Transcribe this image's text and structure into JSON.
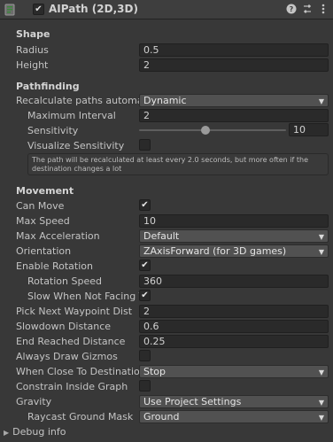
{
  "header": {
    "title": "AIPath (2D,3D)",
    "enabled_mark": "✔",
    "icons": [
      "script-icon",
      "help-icon",
      "preset-icon",
      "context-menu-icon"
    ]
  },
  "shape": {
    "heading": "Shape",
    "radius_label": "Radius",
    "radius_value": "0.5",
    "height_label": "Height",
    "height_value": "2"
  },
  "pathfinding": {
    "heading": "Pathfinding",
    "recalc_label": "Recalculate paths automatic",
    "recalc_value": "Dynamic",
    "max_interval_label": "Maximum Interval",
    "max_interval_value": "2",
    "sensitivity_label": "Sensitivity",
    "sensitivity_value": "10",
    "sensitivity_fraction": 0.45,
    "visualize_label": "Visualize Sensitivity",
    "help_text": "The path will be recalculated at least every 2.0 seconds, but more often if the destination changes a lot"
  },
  "movement": {
    "heading": "Movement",
    "can_move_label": "Can Move",
    "max_speed_label": "Max Speed",
    "max_speed_value": "10",
    "max_accel_label": "Max Acceleration",
    "max_accel_value": "Default",
    "orientation_label": "Orientation",
    "orientation_value": "ZAxisForward (for 3D games)",
    "enable_rotation_label": "Enable Rotation",
    "rotation_speed_label": "Rotation Speed",
    "rotation_speed_value": "360",
    "slow_not_facing_label": "Slow When Not Facing Tar",
    "pick_next_label": "Pick Next Waypoint Dist",
    "pick_next_value": "2",
    "slowdown_label": "Slowdown Distance",
    "slowdown_value": "0.6",
    "end_reached_label": "End Reached Distance",
    "end_reached_value": "0.25",
    "always_draw_label": "Always Draw Gizmos",
    "when_close_label": "When Close To Destination",
    "when_close_value": "Stop",
    "constrain_label": "Constrain Inside Graph",
    "gravity_label": "Gravity",
    "gravity_value": "Use Project Settings",
    "raycast_label": "Raycast Ground Mask",
    "raycast_value": "Ground"
  },
  "debug": {
    "label": "Debug info"
  },
  "checkmark": "✔"
}
